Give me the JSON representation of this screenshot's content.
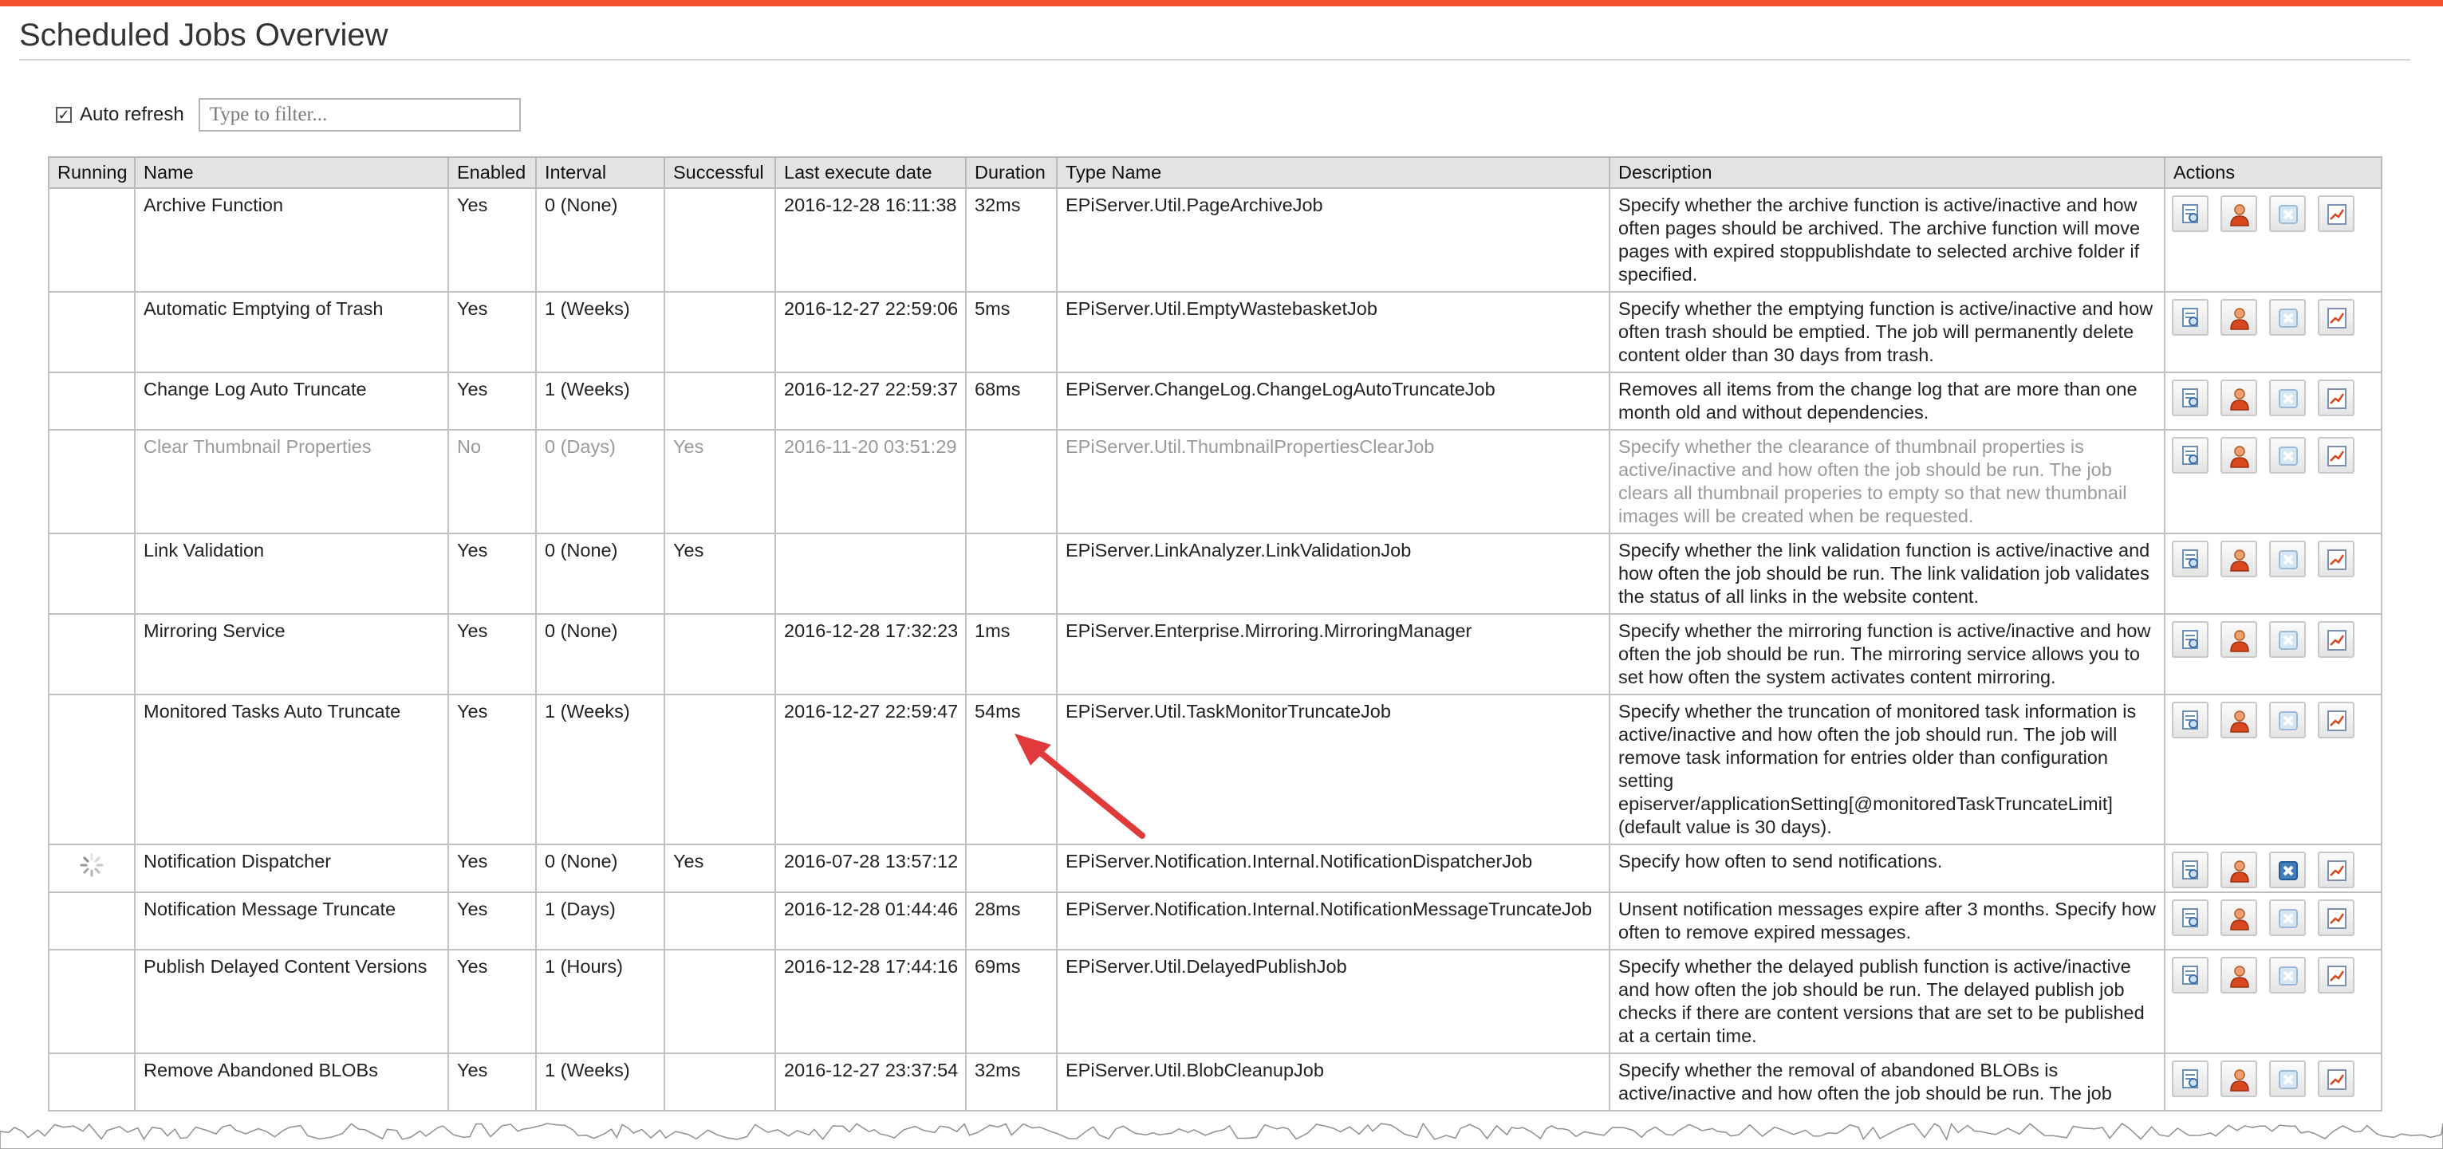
{
  "page": {
    "title": "Scheduled Jobs Overview"
  },
  "toolbar": {
    "auto_refresh_label": "Auto refresh",
    "auto_refresh_checked": true,
    "filter_placeholder": "Type to filter..."
  },
  "table": {
    "headers": {
      "running": "Running",
      "name": "Name",
      "enabled": "Enabled",
      "interval": "Interval",
      "successful": "Successful",
      "last_execute": "Last execute date",
      "duration": "Duration",
      "type_name": "Type Name",
      "description": "Description",
      "actions": "Actions"
    },
    "rows": [
      {
        "running": false,
        "name": "Archive Function",
        "enabled": "Yes",
        "interval": "0 (None)",
        "successful": "",
        "last_execute": "2016-12-28 16:11:38",
        "duration": "32ms",
        "type_name": "EPiServer.Util.PageArchiveJob",
        "description": "Specify whether the archive function is active/inactive and how often pages should be archived. The archive function will move pages with expired stoppublishdate to selected archive folder if specified.",
        "disabled": false
      },
      {
        "running": false,
        "name": "Automatic Emptying of Trash",
        "enabled": "Yes",
        "interval": "1 (Weeks)",
        "successful": "",
        "last_execute": "2016-12-27 22:59:06",
        "duration": "5ms",
        "type_name": "EPiServer.Util.EmptyWastebasketJob",
        "description": "Specify whether the emptying function is active/inactive and how often trash should be emptied. The job will permanently delete content older than 30 days from trash.",
        "disabled": false
      },
      {
        "running": false,
        "name": "Change Log Auto Truncate",
        "enabled": "Yes",
        "interval": "1 (Weeks)",
        "successful": "",
        "last_execute": "2016-12-27 22:59:37",
        "duration": "68ms",
        "type_name": "EPiServer.ChangeLog.ChangeLogAutoTruncateJob",
        "description": "Removes all items from the change log that are more than one month old and without dependencies.",
        "disabled": false
      },
      {
        "running": false,
        "name": "Clear Thumbnail Properties",
        "enabled": "No",
        "interval": "0 (Days)",
        "successful": "Yes",
        "last_execute": "2016-11-20 03:51:29",
        "duration": "",
        "type_name": "EPiServer.Util.ThumbnailPropertiesClearJob",
        "description": "Specify whether the clearance of thumbnail properties is active/inactive and how often the job should be run. The job clears all thumbnail properies to empty so that new thumbnail images will be created when be requested.",
        "disabled": true
      },
      {
        "running": false,
        "name": "Link Validation",
        "enabled": "Yes",
        "interval": "0 (None)",
        "successful": "Yes",
        "last_execute": "",
        "duration": "",
        "type_name": "EPiServer.LinkAnalyzer.LinkValidationJob",
        "description": "Specify whether the link validation function is active/inactive and how often the job should be run. The link validation job validates the status of all links in the website content.",
        "disabled": false
      },
      {
        "running": false,
        "name": "Mirroring Service",
        "enabled": "Yes",
        "interval": "0 (None)",
        "successful": "",
        "last_execute": "2016-12-28 17:32:23",
        "duration": "1ms",
        "type_name": "EPiServer.Enterprise.Mirroring.MirroringManager",
        "description": "Specify whether the mirroring function is active/inactive and how often the job should be run. The mirroring service allows you to set how often the system activates content mirroring.",
        "disabled": false
      },
      {
        "running": false,
        "name": "Monitored Tasks Auto Truncate",
        "enabled": "Yes",
        "interval": "1 (Weeks)",
        "successful": "",
        "last_execute": "2016-12-27 22:59:47",
        "duration": "54ms",
        "type_name": "EPiServer.Util.TaskMonitorTruncateJob",
        "description": "Specify whether the truncation of monitored task information is active/inactive and how often the job should run. The job will remove task information for entries older than configuration setting episerver/applicationSetting[@monitoredTaskTruncateLimit] (default value is 30 days).",
        "disabled": false
      },
      {
        "running": true,
        "name": "Notification Dispatcher",
        "enabled": "Yes",
        "interval": "0 (None)",
        "successful": "Yes",
        "last_execute": "2016-07-28 13:57:12",
        "duration": "",
        "type_name": "EPiServer.Notification.Internal.NotificationDispatcherJob",
        "description": "Specify how often to send notifications.",
        "disabled": false
      },
      {
        "running": false,
        "name": "Notification Message Truncate",
        "enabled": "Yes",
        "interval": "1 (Days)",
        "successful": "",
        "last_execute": "2016-12-28 01:44:46",
        "duration": "28ms",
        "type_name": "EPiServer.Notification.Internal.NotificationMessageTruncateJob",
        "description": "Unsent notification messages expire after 3 months. Specify how often to remove expired messages.",
        "disabled": false
      },
      {
        "running": false,
        "name": "Publish Delayed Content Versions",
        "enabled": "Yes",
        "interval": "1 (Hours)",
        "successful": "",
        "last_execute": "2016-12-28 17:44:16",
        "duration": "69ms",
        "type_name": "EPiServer.Util.DelayedPublishJob",
        "description": "Specify whether the delayed publish function is active/inactive and how often the job should be run. The delayed publish job checks if there are content versions that are set to be published at a certain time.",
        "disabled": false
      },
      {
        "running": false,
        "name": "Remove Abandoned BLOBs",
        "enabled": "Yes",
        "interval": "1 (Weeks)",
        "successful": "",
        "last_execute": "2016-12-27 23:37:54",
        "duration": "32ms",
        "type_name": "EPiServer.Util.BlobCleanupJob",
        "description": "Specify whether the removal of abandoned BLOBs is active/inactive and how often the job should be run. The job",
        "disabled": false
      }
    ]
  },
  "icons": {
    "details": "details-icon",
    "run_as_user": "user-icon",
    "stop": "stop-icon",
    "log": "log-chart-icon"
  },
  "colors": {
    "accent_bar": "#f1512c",
    "annotation_arrow": "#e03a3a",
    "header_bg": "#e3e3e3",
    "disabled_text": "#9a9a9a"
  }
}
